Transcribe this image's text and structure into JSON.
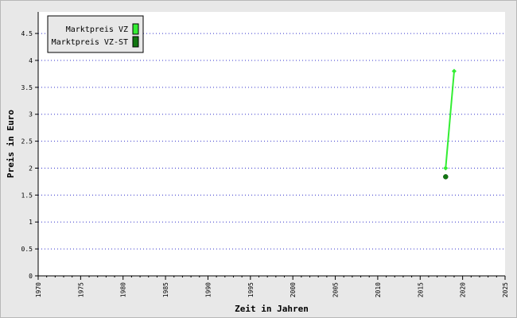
{
  "chart_data": {
    "type": "line",
    "xlabel": "Zeit in Jahren",
    "ylabel": "Preis in Euro",
    "xlim": [
      1970,
      2025
    ],
    "ylim": [
      0,
      4.9
    ],
    "x_ticks": [
      1970,
      1975,
      1980,
      1985,
      1990,
      1995,
      2000,
      2005,
      2010,
      2015,
      2020,
      2025
    ],
    "y_ticks": [
      0,
      0.5,
      1,
      1.5,
      2,
      2.5,
      3,
      3.5,
      4,
      4.5
    ],
    "y_tick_labels": [
      "0",
      "0.5",
      "1",
      "1.5",
      "2",
      "2.5",
      "3",
      "3.5",
      "4",
      "4.5"
    ],
    "grid": "horizontal dotted",
    "legend_position": "top-left",
    "series": [
      {
        "name": "Marktpreis VZ",
        "color": "#33ee33",
        "marker": "diamond",
        "points": [
          [
            2018,
            2.0
          ],
          [
            2019,
            3.8
          ]
        ]
      },
      {
        "name": "Marktpreis VZ-ST",
        "color": "#117711",
        "marker": "circle",
        "points": [
          [
            2018,
            1.84
          ]
        ]
      }
    ]
  }
}
